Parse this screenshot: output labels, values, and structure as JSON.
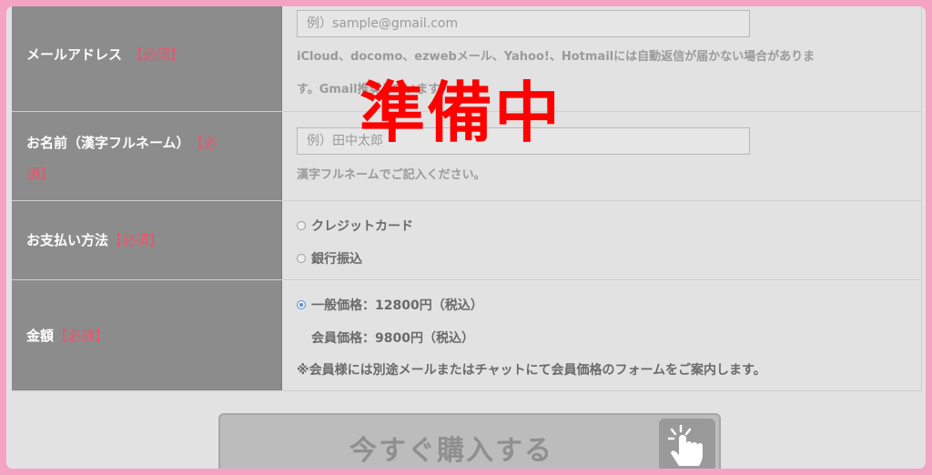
{
  "overlay": {
    "stamp": "準備中"
  },
  "form": {
    "email": {
      "label": "メールアドレス",
      "required": "【必須】",
      "placeholder": "例）sample@gmail.com",
      "note_line1": "iCloud、docomo、ezwebメール、Yahoo!、Hotmailには自動返信が届かない場合がありま",
      "note_line2": "す。Gmail推奨しています。"
    },
    "name": {
      "label": "お名前（漢字フルネーム）",
      "required_part1": "【必",
      "required_part2": "須】",
      "placeholder": "例）田中太郎",
      "note": "漢字フルネームでご記入ください。"
    },
    "payment": {
      "label": "お支払い方法",
      "required": "【必須】",
      "options": [
        "クレジットカード",
        "銀行振込"
      ]
    },
    "price": {
      "label": "金額",
      "required": "【必須】",
      "general": "一般価格：12800円（税込）",
      "member": "会員価格：9800円（税込）",
      "note": "※会員様には別途メールまたはチャットにて会員価格のフォームをご案内します。"
    }
  },
  "buy_button": {
    "label": "今すぐ購入する"
  },
  "colors": {
    "frame": "#f5a3c2",
    "label_bg": "#8c8c8c",
    "required": "#e8566b",
    "stamp": "#ff0000",
    "radio_checked": "#5b8fd8"
  }
}
